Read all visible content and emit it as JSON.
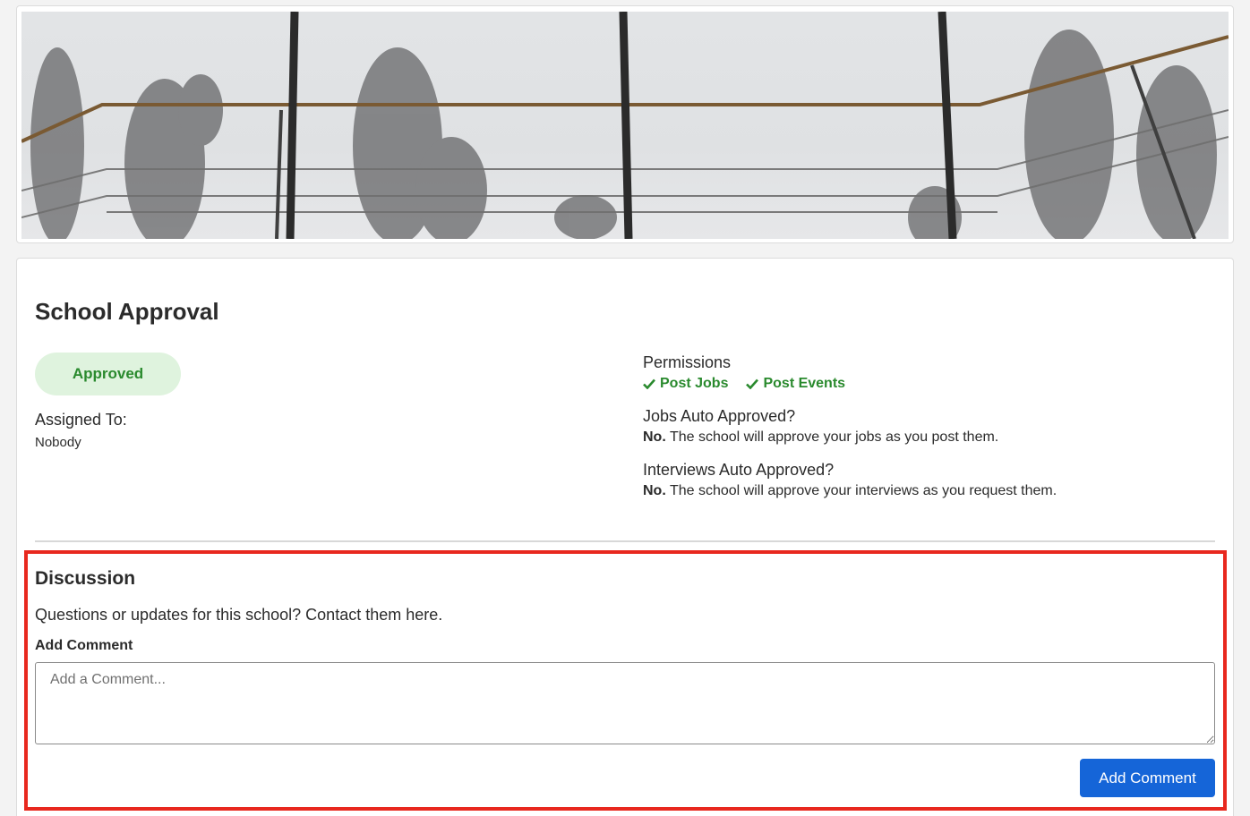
{
  "approval": {
    "title": "School Approval",
    "status": "Approved",
    "assigned_label": "Assigned To:",
    "assigned_value": "Nobody"
  },
  "permissions": {
    "title": "Permissions",
    "items": [
      {
        "label": "Post Jobs",
        "icon": "check-icon"
      },
      {
        "label": "Post Events",
        "icon": "check-icon"
      }
    ]
  },
  "jobs_auto": {
    "question": "Jobs Auto Approved?",
    "answer_bold": "No.",
    "answer_text": " The school will approve your jobs as you post them."
  },
  "interviews_auto": {
    "question": "Interviews Auto Approved?",
    "answer_bold": "No.",
    "answer_text": " The school will approve your interviews as you request them."
  },
  "discussion": {
    "title": "Discussion",
    "description": "Questions or updates for this school? Contact them here.",
    "add_label": "Add Comment",
    "placeholder": "Add a Comment...",
    "button_label": "Add Comment"
  },
  "colors": {
    "approved_bg": "#dff3de",
    "approved_text": "#2a8a2e",
    "primary_button": "#1565d8",
    "highlight_border": "#e8281e"
  }
}
